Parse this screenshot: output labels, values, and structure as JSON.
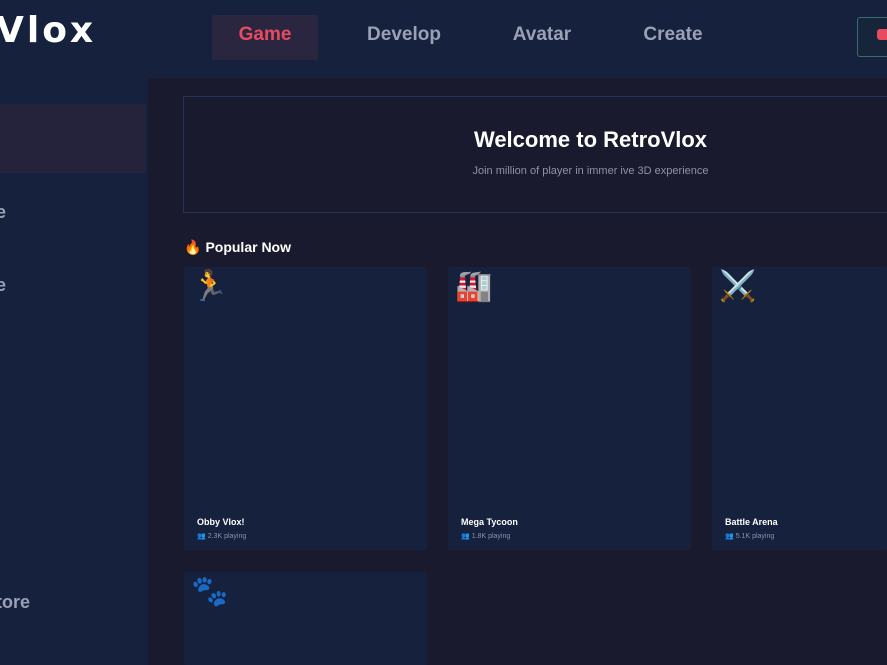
{
  "app": {
    "logo": "Vlox"
  },
  "nav": {
    "tabs": [
      {
        "label": "Game",
        "active": true
      },
      {
        "label": "Develop",
        "active": false
      },
      {
        "label": "Avatar",
        "active": false
      },
      {
        "label": "Create",
        "active": false
      }
    ]
  },
  "sidebar": {
    "items": [
      {
        "label": ""
      },
      {
        "label": "e"
      },
      {
        "label": "e"
      },
      {
        "label": "."
      },
      {
        "label": "tore"
      }
    ]
  },
  "banner": {
    "title": "Welcome to RetroVlox",
    "subtitle": "Join million  of player  in immer ive 3D experience"
  },
  "section": {
    "icon": "fire-icon",
    "title": "Popular Now"
  },
  "games": [
    {
      "icon": "runner-icon",
      "glyph": "🏃",
      "name": "Obby Vlox!",
      "players": "2.3K playing"
    },
    {
      "icon": "factory-icon",
      "glyph": "🏭",
      "name": "Mega Tycoon",
      "players": "1.8K playing"
    },
    {
      "icon": "crossed-swords-icon",
      "glyph": "⚔️",
      "name": "Battle Arena",
      "players": "5.1K playing"
    },
    {
      "icon": "paw-prints-icon",
      "glyph": "🐾",
      "name": "",
      "players": ""
    }
  ],
  "colors": {
    "accent": "#e84a5f",
    "panel": "#16213e",
    "background": "#1a1a2e"
  }
}
